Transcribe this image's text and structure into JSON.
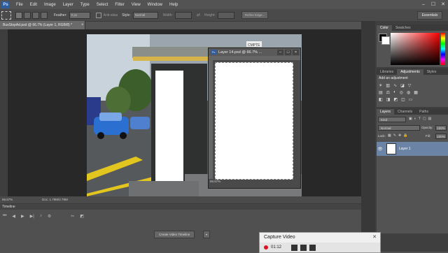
{
  "menubar": {
    "logo": "Ps",
    "items": [
      "File",
      "Edit",
      "Image",
      "Layer",
      "Type",
      "Select",
      "Filter",
      "View",
      "Window",
      "Help"
    ]
  },
  "options": {
    "feather_label": "Feather:",
    "feather_value": "0 px",
    "antialias_label": "Anti-alias",
    "style_label": "Style:",
    "style_value": "Normal",
    "width_label": "Width:",
    "height_label": "Height:",
    "refine_edge": "Refine Edge...",
    "workspace": "Essentials"
  },
  "document": {
    "tab_title": "BusStopAd.psd @ 66.7% (Layer 1, RGB/8) *",
    "zoom": "66.67%",
    "doc_info": "Doc: 1.79M/2.79M"
  },
  "photo": {
    "sign_text": "CMPTE"
  },
  "float_window": {
    "title": "Layer 14.psd @ 66.7% ...",
    "zoom": "66.67%"
  },
  "timeline": {
    "title": "Timeline",
    "create_button": "Create Video Timeline"
  },
  "panels": {
    "color_tabs": [
      "Color",
      "Swatches"
    ],
    "adjust_tabs": [
      "Libraries",
      "Adjustments",
      "Styles"
    ],
    "adjust_hint": "Add an adjustment",
    "layers_tabs": [
      "Layers",
      "Channels",
      "Paths"
    ],
    "kind_label": "Kind",
    "blend_mode": "Normal",
    "opacity_label": "Opacity:",
    "opacity_value": "100%",
    "lock_label": "Lock:",
    "fill_label": "Fill:",
    "fill_value": "100%",
    "layer_name": "Layer 1"
  },
  "capture": {
    "title": "Capture Video",
    "timer": "01:12"
  },
  "colors": {
    "selected_layer": "#6b84a6",
    "gradient_red": "#ff0000"
  }
}
